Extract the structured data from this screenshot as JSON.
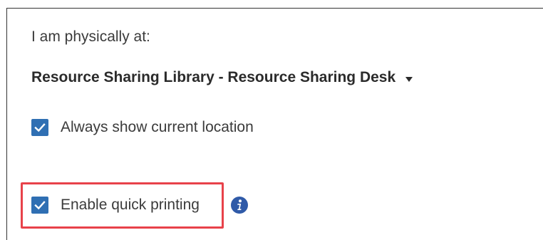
{
  "location": {
    "prompt": "I am physically at:",
    "selected": "Resource Sharing Library - Resource Sharing Desk",
    "dropdown_icon": "caret-down-icon"
  },
  "options": {
    "always_show": {
      "label": "Always show current location",
      "checked": true
    },
    "quick_printing": {
      "label": "Enable quick printing",
      "checked": true,
      "info_icon": "info-icon"
    }
  },
  "colors": {
    "checkbox": "#2f6fb3",
    "info_icon": "#2f5aa8",
    "highlight": "#e8424a",
    "text": "#3b3b3b"
  }
}
